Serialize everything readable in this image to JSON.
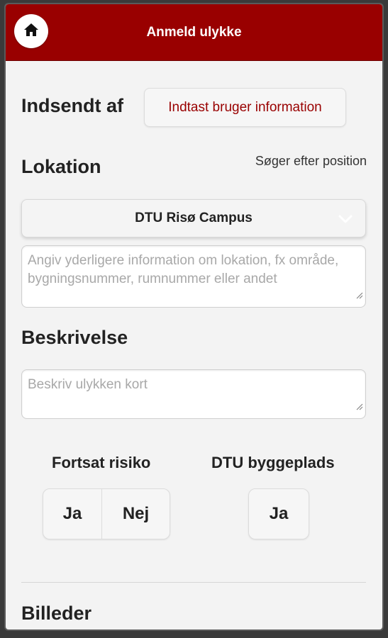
{
  "header": {
    "title": "Anmeld ulykke",
    "home_icon": "home-icon",
    "color": "#990000"
  },
  "submitted_by": {
    "heading": "Indsendt af",
    "button_label": "Indtast bruger information"
  },
  "location": {
    "heading": "Lokation",
    "status": "Søger efter position",
    "selected": "DTU Risø Campus",
    "details_placeholder": "Angiv yderligere information om lokation, fx område, bygningsnummer, rumnummer eller andet"
  },
  "description": {
    "heading": "Beskrivelse",
    "placeholder": "Beskriv ulykken kort"
  },
  "continued_risk": {
    "label": "Fortsat risiko",
    "yes": "Ja",
    "no": "Nej"
  },
  "construction_site": {
    "label": "DTU byggeplads",
    "yes": "Ja"
  },
  "images": {
    "heading": "Billeder"
  }
}
